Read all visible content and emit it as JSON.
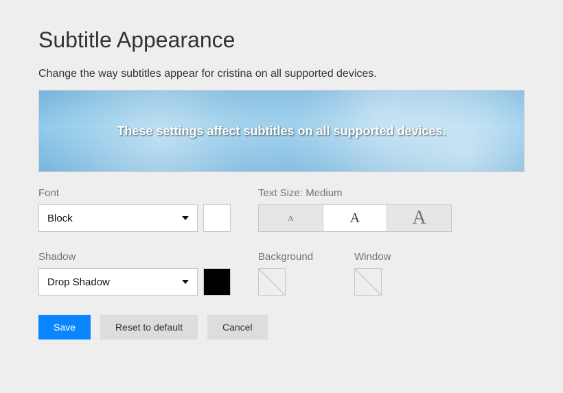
{
  "page": {
    "title": "Subtitle Appearance",
    "description": "Change the way subtitles appear for cristina on all supported devices."
  },
  "preview": {
    "sample_text": "These settings affect subtitles on all supported devices."
  },
  "font": {
    "label": "Font",
    "selected": "Block",
    "color": "#ffffff"
  },
  "text_size": {
    "label": "Text Size: Medium",
    "glyph_small": "A",
    "glyph_medium": "A",
    "glyph_large": "A",
    "selected": "medium"
  },
  "shadow": {
    "label": "Shadow",
    "selected": "Drop Shadow",
    "color": "#000000"
  },
  "background": {
    "label": "Background",
    "color": "none"
  },
  "window": {
    "label": "Window",
    "color": "none"
  },
  "buttons": {
    "save": "Save",
    "reset": "Reset to default",
    "cancel": "Cancel"
  }
}
